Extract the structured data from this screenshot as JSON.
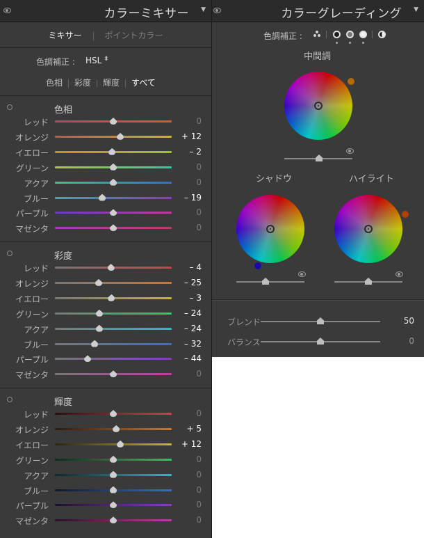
{
  "mixer": {
    "title": "カラーミキサー",
    "tabs": [
      "ミキサー",
      "ポイントカラー"
    ],
    "adjust_label": "色調補正 :",
    "adjust_value": "HSL",
    "subtabs": [
      "色相",
      "彩度",
      "輝度",
      "すべて"
    ],
    "sections": [
      {
        "title": "色相",
        "rows": [
          {
            "label": "レッド",
            "value": "0",
            "level": 0
          },
          {
            "label": "オレンジ",
            "value": "+ 12",
            "level": 12
          },
          {
            "label": "イエロー",
            "value": "– 2",
            "level": -2
          },
          {
            "label": "グリーン",
            "value": "0",
            "level": 0
          },
          {
            "label": "アクア",
            "value": "0",
            "level": 0
          },
          {
            "label": "ブルー",
            "value": "– 19",
            "level": -19
          },
          {
            "label": "パープル",
            "value": "0",
            "level": 0
          },
          {
            "label": "マゼンタ",
            "value": "0",
            "level": 0
          }
        ]
      },
      {
        "title": "彩度",
        "rows": [
          {
            "label": "レッド",
            "value": "– 4",
            "level": -4
          },
          {
            "label": "オレンジ",
            "value": "– 25",
            "level": -25
          },
          {
            "label": "イエロー",
            "value": "– 3",
            "level": -3
          },
          {
            "label": "グリーン",
            "value": "– 24",
            "level": -24
          },
          {
            "label": "アクア",
            "value": "– 24",
            "level": -24
          },
          {
            "label": "ブルー",
            "value": "– 32",
            "level": -32
          },
          {
            "label": "パープル",
            "value": "– 44",
            "level": -44
          },
          {
            "label": "マゼンタ",
            "value": "0",
            "level": 0
          }
        ]
      },
      {
        "title": "輝度",
        "rows": [
          {
            "label": "レッド",
            "value": "0",
            "level": 0
          },
          {
            "label": "オレンジ",
            "value": "+ 5",
            "level": 5
          },
          {
            "label": "イエロー",
            "value": "+ 12",
            "level": 12
          },
          {
            "label": "グリーン",
            "value": "0",
            "level": 0
          },
          {
            "label": "アクア",
            "value": "0",
            "level": 0
          },
          {
            "label": "ブルー",
            "value": "0",
            "level": 0
          },
          {
            "label": "パープル",
            "value": "0",
            "level": 0
          },
          {
            "label": "マゼンタ",
            "value": "0",
            "level": 0
          }
        ]
      }
    ]
  },
  "grading": {
    "title": "カラーグレーディング",
    "adjust_label": "色調補正 :",
    "midtones_label": "中間調",
    "shadows_label": "シャドウ",
    "highlights_label": "ハイライト",
    "blend_label": "ブレンド",
    "blend_value": "50",
    "balance_label": "バランス",
    "balance_value": "0",
    "midtone_handle_color": "#b36a00",
    "shadow_handle_color": "#1a0aa8",
    "highlight_handle_color": "#b04000",
    "blend_level": 50,
    "balance_level": 0
  },
  "colors": {
    "panel": "#3a3a3a",
    "header": "#2b2b2b",
    "text": "#cfcfcf"
  },
  "icons": [
    "eye-icon",
    "collapse-triangle-icon",
    "three-circles-icon",
    "shadow-circle-icon",
    "midtone-circle-icon",
    "highlight-circle-icon",
    "global-circle-icon",
    "stepper-icon"
  ]
}
